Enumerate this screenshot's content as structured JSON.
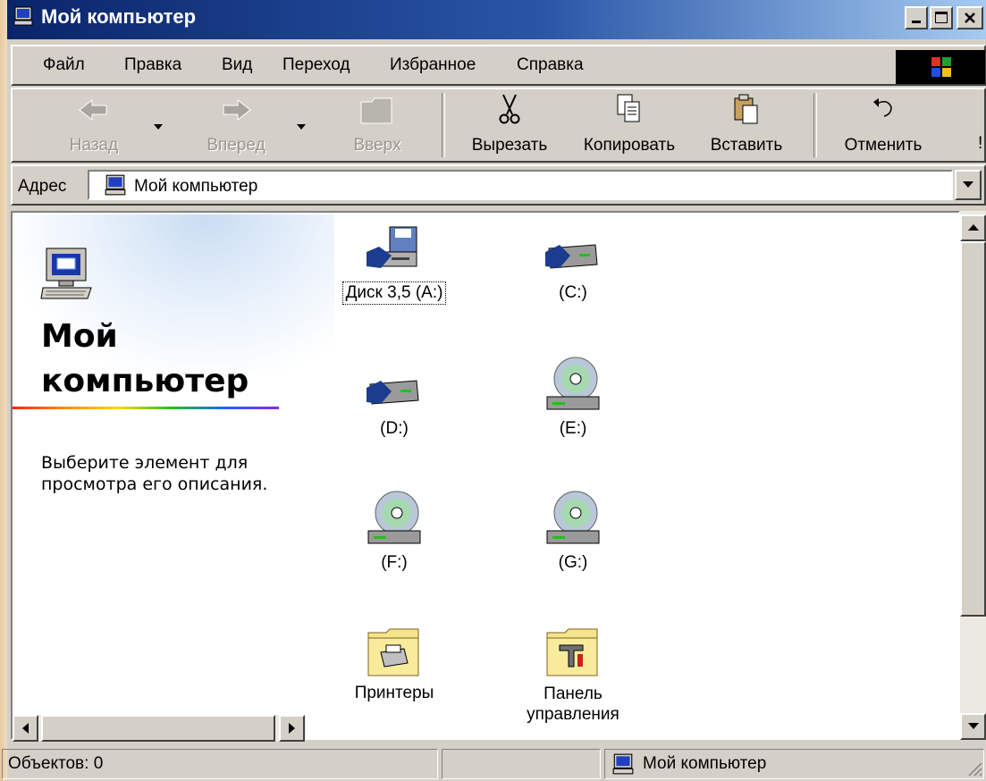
{
  "window": {
    "title": "Мой компьютер"
  },
  "menu": [
    "Файл",
    "Правка",
    "Вид",
    "Переход",
    "Избранное",
    "Справка"
  ],
  "toolbar": {
    "back": "Назад",
    "forward": "Вперед",
    "up": "Вверх",
    "cut": "Вырезать",
    "copy": "Копировать",
    "paste": "Вставить",
    "undo": "Отменить"
  },
  "address": {
    "label": "Адрес",
    "value": "Мой компьютер"
  },
  "webview": {
    "title_line1": "Мой",
    "title_line2": "компьютер",
    "description": "Выберите элемент для просмотра его описания."
  },
  "items": [
    {
      "label": "Диск 3,5 (A:)",
      "icon": "floppy-drive-icon"
    },
    {
      "label": "(C:)",
      "icon": "hard-drive-icon"
    },
    {
      "label": "(D:)",
      "icon": "hard-drive-icon"
    },
    {
      "label": "(E:)",
      "icon": "cd-drive-icon"
    },
    {
      "label": "(F:)",
      "icon": "cd-drive-icon"
    },
    {
      "label": "(G:)",
      "icon": "cd-drive-icon"
    },
    {
      "label": "Принтеры",
      "icon": "printers-folder-icon"
    },
    {
      "label_line1": "Панель",
      "label_line2": "управления",
      "icon": "control-panel-folder-icon"
    }
  ],
  "status": {
    "objects": "Объектов: 0",
    "location": "Мой компьютер"
  }
}
